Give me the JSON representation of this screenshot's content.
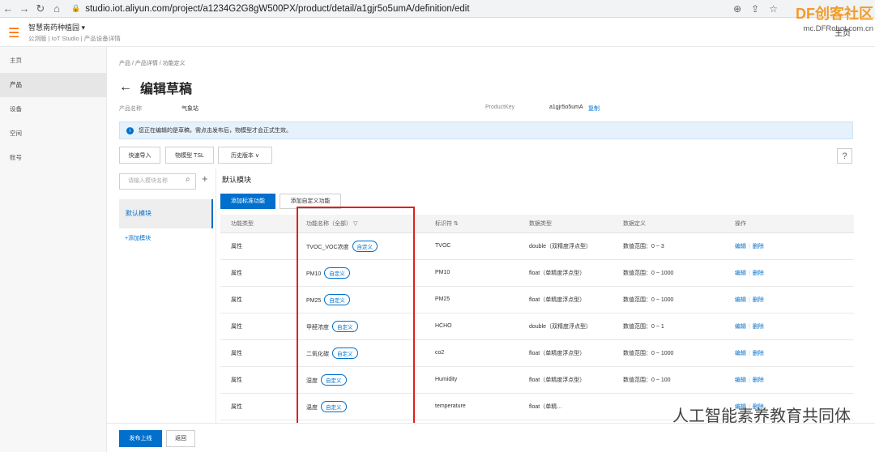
{
  "browser": {
    "url": "studio.iot.aliyun.com/project/a1234G2G8gW500PX/product/detail/a1gjr5o5umA/definition/edit"
  },
  "header": {
    "brand": "智慧南药种植园 ▾",
    "sub": "公测版 | IoT Studio | 产品设备详情",
    "user": "主页"
  },
  "sidebar": {
    "items": [
      {
        "label": "主页"
      },
      {
        "label": "产品"
      },
      {
        "label": "设备"
      },
      {
        "label": "空间"
      },
      {
        "label": "账号"
      }
    ]
  },
  "breadcrumb": "产品  /  产品详情  /  功能定义",
  "page": {
    "title": "编辑草稿",
    "product_name_label": "产品名称",
    "product_name": "气象站",
    "product_key_label": "ProductKey",
    "product_key": "a1gjr5o5umA",
    "copy": "复制",
    "notice": "您正在编辑的是草稿，需点击发布后，物模型才会正式生效。"
  },
  "toolbar": {
    "quick_import": "快速导入",
    "tsl": "物模型 TSL",
    "history": "历史版本 ∨",
    "help": "?"
  },
  "modules": {
    "search_placeholder": "请输入模块名称",
    "default": "默认模块",
    "add": "+添加模块",
    "section_title": "默认模块"
  },
  "tabs": {
    "standard": "添加标准功能",
    "custom": "添加自定义功能"
  },
  "table": {
    "headers": [
      "功能类型",
      "功能名称（全部）",
      "标识符",
      "数据类型",
      "数据定义",
      "操作"
    ],
    "rows": [
      [
        "属性",
        "TVOC_VOC浓度",
        "TVOC",
        "double（双精度浮点型）",
        "数值范围：0 ~ 3"
      ],
      [
        "属性",
        "PM10",
        "PM10",
        "float（单精度浮点型）",
        "数值范围：0 ~ 1000"
      ],
      [
        "属性",
        "PM25",
        "PM25",
        "float（单精度浮点型）",
        "数值范围：0 ~ 1000"
      ],
      [
        "属性",
        "甲醛浓度",
        "HCHO",
        "double（双精度浮点型）",
        "数值范围：0 ~ 1"
      ],
      [
        "属性",
        "二氧化碳",
        "co2",
        "float（单精度浮点型）",
        "数值范围：0 ~ 1000"
      ],
      [
        "属性",
        "湿度",
        "Humidity",
        "float（单精度浮点型）",
        "数值范围：0 ~ 100"
      ],
      [
        "属性",
        "温度",
        "temperature",
        "float（单精…",
        ""
      ]
    ],
    "tag": "自定义",
    "edit": "编辑",
    "delete": "删除"
  },
  "footer": {
    "publish": "发布上线",
    "back": "返回"
  },
  "watermark": {
    "site": "DF创客社区",
    "domain": "mc.DFRobot.com.cn",
    "wechat": "人工智能素养教育共同体"
  }
}
